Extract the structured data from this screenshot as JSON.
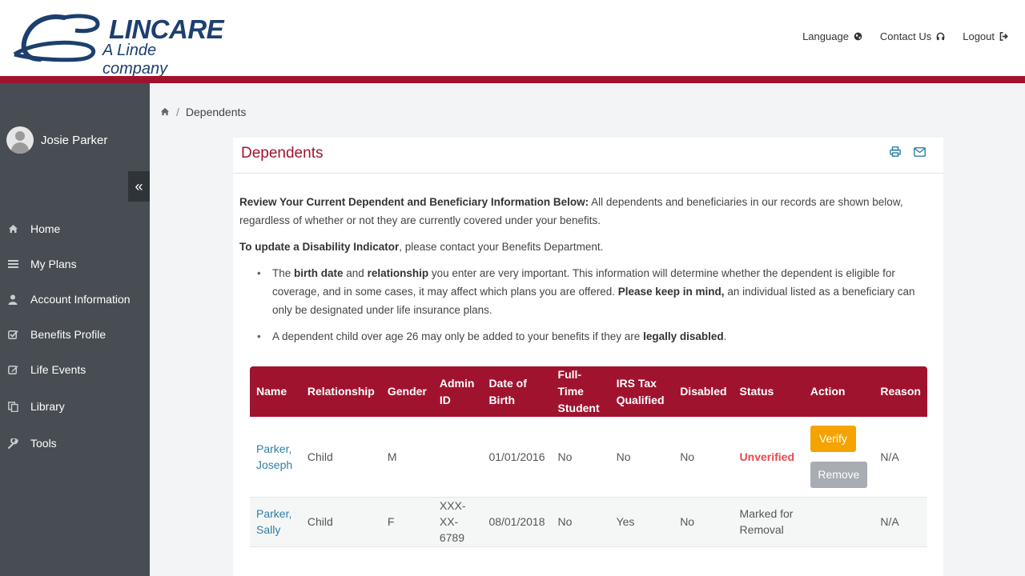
{
  "brand": {
    "name": "LINCARE",
    "tagline": "A Linde company"
  },
  "toplinks": {
    "language": "Language",
    "contact": "Contact Us",
    "logout": "Logout"
  },
  "user": {
    "name": "Josie Parker"
  },
  "sidebar": {
    "collapse_label": "«",
    "items": [
      {
        "label": "Home",
        "icon": "home-icon"
      },
      {
        "label": "My Plans",
        "icon": "list-icon"
      },
      {
        "label": "Account Information",
        "icon": "user-icon"
      },
      {
        "label": "Benefits Profile",
        "icon": "check-square-icon"
      },
      {
        "label": "Life Events",
        "icon": "edit-icon"
      },
      {
        "label": "Library",
        "icon": "copy-icon"
      },
      {
        "label": "Tools",
        "icon": "wrench-icon"
      }
    ]
  },
  "breadcrumb": {
    "separator": "/",
    "current": "Dependents"
  },
  "panel": {
    "title": "Dependents",
    "intro_bold": "Review Your Current Dependent and Beneficiary Information Below:",
    "intro_text": " All dependents and beneficiaries in our records are shown below, regardless of whether or not they are currently covered under your benefits.",
    "disability_bold": "To update a Disability Indicator",
    "disability_text": ", please contact your Benefits Department.",
    "bullet1": {
      "t1": "The ",
      "b1": "birth date",
      "t2": " and ",
      "b2": "relationship",
      "t3": " you enter are very important. This information will determine whether the dependent is eligible for coverage, and in some cases, it may affect which plans you are offered. ",
      "b3": "Please keep in mind,",
      "t4": " an individual listed as a beneficiary can only be designated under life insurance plans."
    },
    "bullet2": {
      "t1": "A dependent child over age 26 may only be added to your benefits if they are ",
      "b1": "legally disabled",
      "t2": "."
    }
  },
  "table": {
    "headers": {
      "name": "Name",
      "relationship": "Relationship",
      "gender": "Gender",
      "admin_id_1": "Admin",
      "admin_id_2": "ID",
      "dob_1": "Date of",
      "dob_2": "Birth",
      "fts_1": "Full-Time",
      "fts_2": "Student",
      "irs_1": "IRS Tax",
      "irs_2": "Qualified",
      "disabled": "Disabled",
      "status": "Status",
      "action": "Action",
      "reason": "Reason"
    },
    "rows": [
      {
        "name_1": "Parker,",
        "name_2": "Joseph",
        "relationship": "Child",
        "gender": "M",
        "admin_id_1": "",
        "admin_id_2": "",
        "dob": "01/01/2016",
        "fts": "No",
        "irs": "No",
        "disabled": "No",
        "status_1": "Unverified",
        "status_2": "",
        "verify_label": "Verify",
        "remove_label": "Remove",
        "reason": "N/A"
      },
      {
        "name_1": "Parker,",
        "name_2": "Sally",
        "relationship": "Child",
        "gender": "F",
        "admin_id_1": "XXX-XX-",
        "admin_id_2": "6789",
        "dob": "08/01/2018",
        "fts": "No",
        "irs": "Yes",
        "disabled": "No",
        "status_1": "Marked for",
        "status_2": "Removal",
        "reason": "N/A"
      }
    ]
  },
  "colors": {
    "brand_red": "#a0132f",
    "brand_blue": "#1c3f6e",
    "sidebar_bg": "#474d53",
    "link": "#2e7fa3",
    "verify": "#f5a300",
    "remove": "#a7adb3",
    "unverified": "#e8484f"
  }
}
